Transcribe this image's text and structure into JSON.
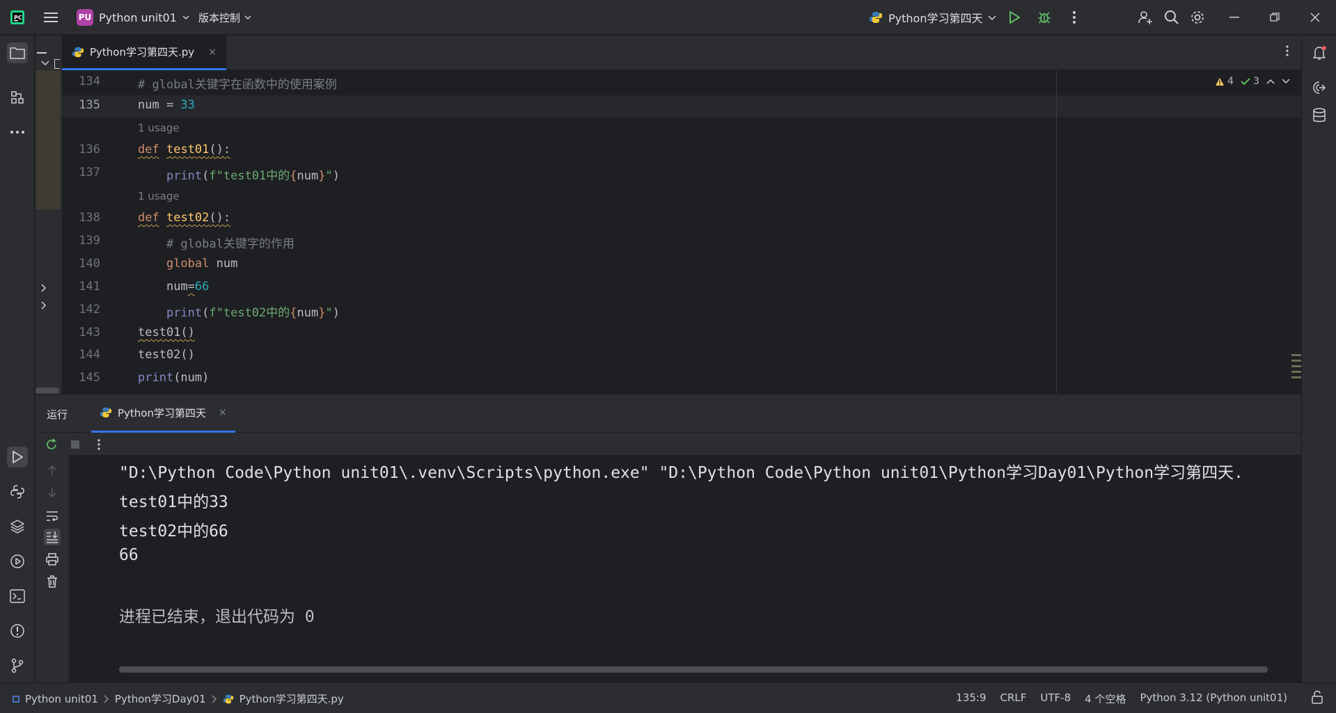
{
  "titlebar": {
    "project_badge": "PU",
    "project_name": "Python unit01",
    "vcs_label": "版本控制",
    "run_config": "Python学习第四天"
  },
  "editor_tab": {
    "filename": "Python学习第四天.py",
    "close": "×"
  },
  "editor": {
    "inspections": {
      "warnings": "4",
      "checks": "3"
    },
    "line_numbers": [
      "134",
      "135",
      "136",
      "137",
      "138",
      "139",
      "140",
      "141",
      "142",
      "143",
      "144",
      "145"
    ],
    "current_line": "135",
    "usage_hint_1": "1 usage",
    "usage_hint_2": "1 usage",
    "code": {
      "l134": "# global关键字在函数中的使用案例",
      "l135_a": "num = ",
      "l135_b": "33",
      "l136_a": "def",
      "l136_b": "test01",
      "l136_c": "():",
      "l137_a": "print",
      "l137_b": "(",
      "l137_c": "f\"test01中的",
      "l137_d": "{",
      "l137_e": "num",
      "l137_f": "}",
      "l137_g": "\"",
      "l137_h": ")",
      "l138_a": "def",
      "l138_b": "test02",
      "l138_c": "():",
      "l139": "# global关键字的作用",
      "l140_a": "global",
      "l140_b": " num",
      "l141_a": "num",
      "l141_b": "=",
      "l141_c": "66",
      "l142_a": "print",
      "l142_b": "(",
      "l142_c": "f\"test02中的",
      "l142_d": "{",
      "l142_e": "num",
      "l142_f": "}",
      "l142_g": "\"",
      "l142_h": ")",
      "l143": "test01()",
      "l144": "test02()",
      "l145_a": "print",
      "l145_b": "(num)"
    }
  },
  "run_window": {
    "title": "运行",
    "tab_label": "Python学习第四天",
    "tab_close": "×",
    "console_lines": [
      "\"D:\\Python Code\\Python unit01\\.venv\\Scripts\\python.exe\" \"D:\\Python Code\\Python unit01\\Python学习Day01\\Python学习第四天.",
      "test01中的33",
      "test02中的66",
      "66",
      "",
      "进程已结束，退出代码为 0"
    ]
  },
  "statusbar": {
    "crumb_project": "Python unit01",
    "crumb_folder": "Python学习Day01",
    "crumb_file": "Python学习第四天.py",
    "position": "135:9",
    "line_ending": "CRLF",
    "encoding": "UTF-8",
    "indent": "4 个空格",
    "interpreter": "Python 3.12 (Python unit01)"
  },
  "icons": {
    "app": "pycharm-logo-icon",
    "menu": "hamburger-menu-icon",
    "run": "run-icon",
    "debug": "debug-icon",
    "search": "search-icon",
    "settings": "gear-icon"
  },
  "colors": {
    "accent": "#3574f0",
    "run_green": "#5fb865",
    "keyword": "#cf8e6d",
    "string": "#6aab73",
    "number": "#2aacb8"
  }
}
